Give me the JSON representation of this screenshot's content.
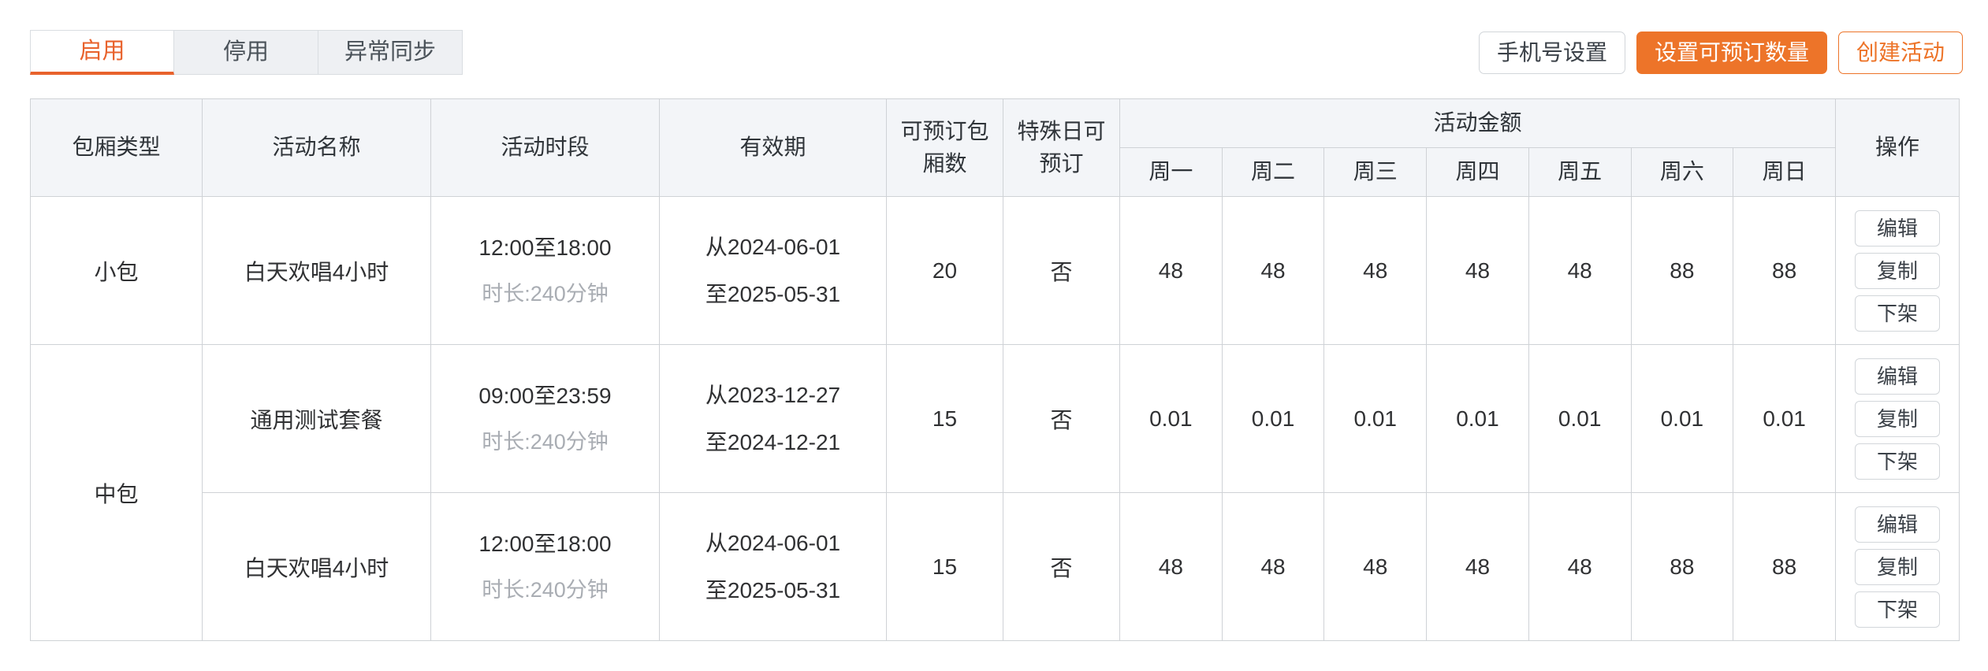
{
  "theme": {
    "accent": "#ed7429",
    "accent_active_tab": "#e8622c",
    "header_bg": "#f3f5f8",
    "border": "#cfd2d6",
    "muted_text": "#a9adb3"
  },
  "tabs": [
    {
      "label": "启用",
      "active": true
    },
    {
      "label": "停用",
      "active": false
    },
    {
      "label": "异常同步",
      "active": false
    }
  ],
  "toolbar": {
    "phone_settings_label": "手机号设置",
    "set_bookable_count_label": "设置可预订数量",
    "create_activity_label": "创建活动"
  },
  "table": {
    "headers": {
      "room_type": "包厢类型",
      "activity_name": "活动名称",
      "time_slot": "活动时段",
      "validity": "有效期",
      "bookable_rooms_line1": "可预订包",
      "bookable_rooms_line2": "厢数",
      "special_day_line1": "特殊日可",
      "special_day_line2": "预订",
      "amount_group": "活动金额",
      "operations": "操作"
    },
    "weekdays": [
      "周一",
      "周二",
      "周三",
      "周四",
      "周五",
      "周六",
      "周日"
    ],
    "op_buttons": [
      "编辑",
      "复制",
      "下架"
    ],
    "rows": [
      {
        "room_type": "小包",
        "room_type_rowspan": 1,
        "activity_name": "白天欢唱4小时",
        "time_slot": "12:00至18:00",
        "duration": "时长:240分钟",
        "valid_from": "从2024-06-01",
        "valid_to": "至2025-05-31",
        "bookable_rooms": "20",
        "special_day": "否",
        "prices": [
          "48",
          "48",
          "48",
          "48",
          "48",
          "88",
          "88"
        ]
      },
      {
        "room_type": "中包",
        "room_type_rowspan": 2,
        "activity_name": "通用测试套餐",
        "time_slot": "09:00至23:59",
        "duration": "时长:240分钟",
        "valid_from": "从2023-12-27",
        "valid_to": "至2024-12-21",
        "bookable_rooms": "15",
        "special_day": "否",
        "prices": [
          "0.01",
          "0.01",
          "0.01",
          "0.01",
          "0.01",
          "0.01",
          "0.01"
        ]
      },
      {
        "room_type": null,
        "room_type_rowspan": 0,
        "activity_name": "白天欢唱4小时",
        "time_slot": "12:00至18:00",
        "duration": "时长:240分钟",
        "valid_from": "从2024-06-01",
        "valid_to": "至2025-05-31",
        "bookable_rooms": "15",
        "special_day": "否",
        "prices": [
          "48",
          "48",
          "48",
          "48",
          "48",
          "88",
          "88"
        ]
      }
    ]
  }
}
